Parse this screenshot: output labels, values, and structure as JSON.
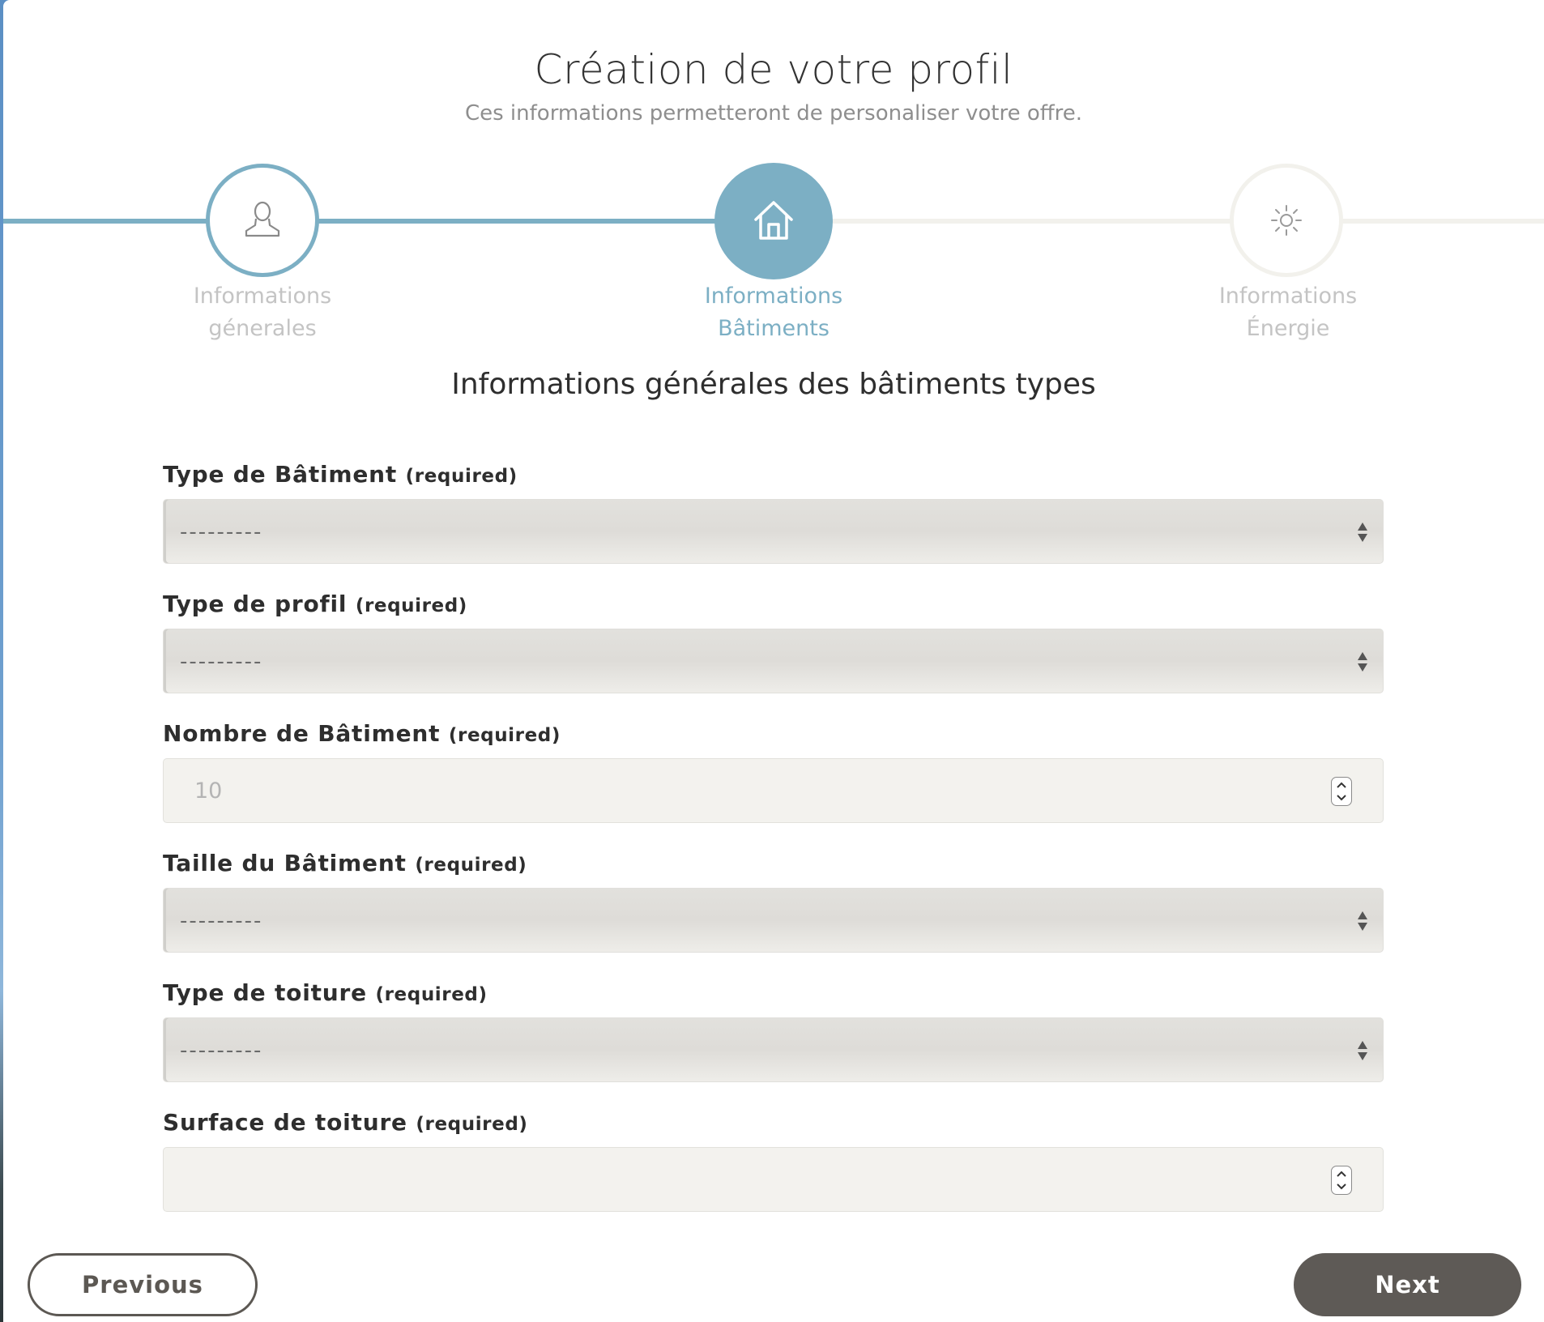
{
  "header": {
    "title": "Création de votre profil",
    "subtitle": "Ces informations permetteront de personaliser votre offre."
  },
  "steps": [
    {
      "label_line1": "Informations",
      "label_line2": "génerales",
      "icon": "user-icon",
      "state": "completed"
    },
    {
      "label_line1": "Informations",
      "label_line2": "Bâtiments",
      "icon": "home-icon",
      "state": "active"
    },
    {
      "label_line1": "Informations",
      "label_line2": "Énergie",
      "icon": "sun-icon",
      "state": "upcoming"
    }
  ],
  "section_title": "Informations générales des bâtiments types",
  "fields": [
    {
      "label": "Type de Bâtiment",
      "required_label": "(required)",
      "type": "select",
      "value": "---------"
    },
    {
      "label": "Type de profil",
      "required_label": "(required)",
      "type": "select",
      "value": "---------"
    },
    {
      "label": "Nombre de Bâtiment",
      "required_label": "(required)",
      "type": "number",
      "value": "10"
    },
    {
      "label": "Taille du Bâtiment",
      "required_label": "(required)",
      "type": "select",
      "value": "---------"
    },
    {
      "label": "Type de toiture",
      "required_label": "(required)",
      "type": "select",
      "value": "---------"
    },
    {
      "label": "Surface de toiture",
      "required_label": "(required)",
      "type": "number",
      "value": ""
    }
  ],
  "buttons": {
    "previous": "Previous",
    "next": "Next"
  },
  "colors": {
    "accent": "#7cafc4",
    "inactive": "#f2f1ec",
    "button_dark": "#5e5a56"
  }
}
